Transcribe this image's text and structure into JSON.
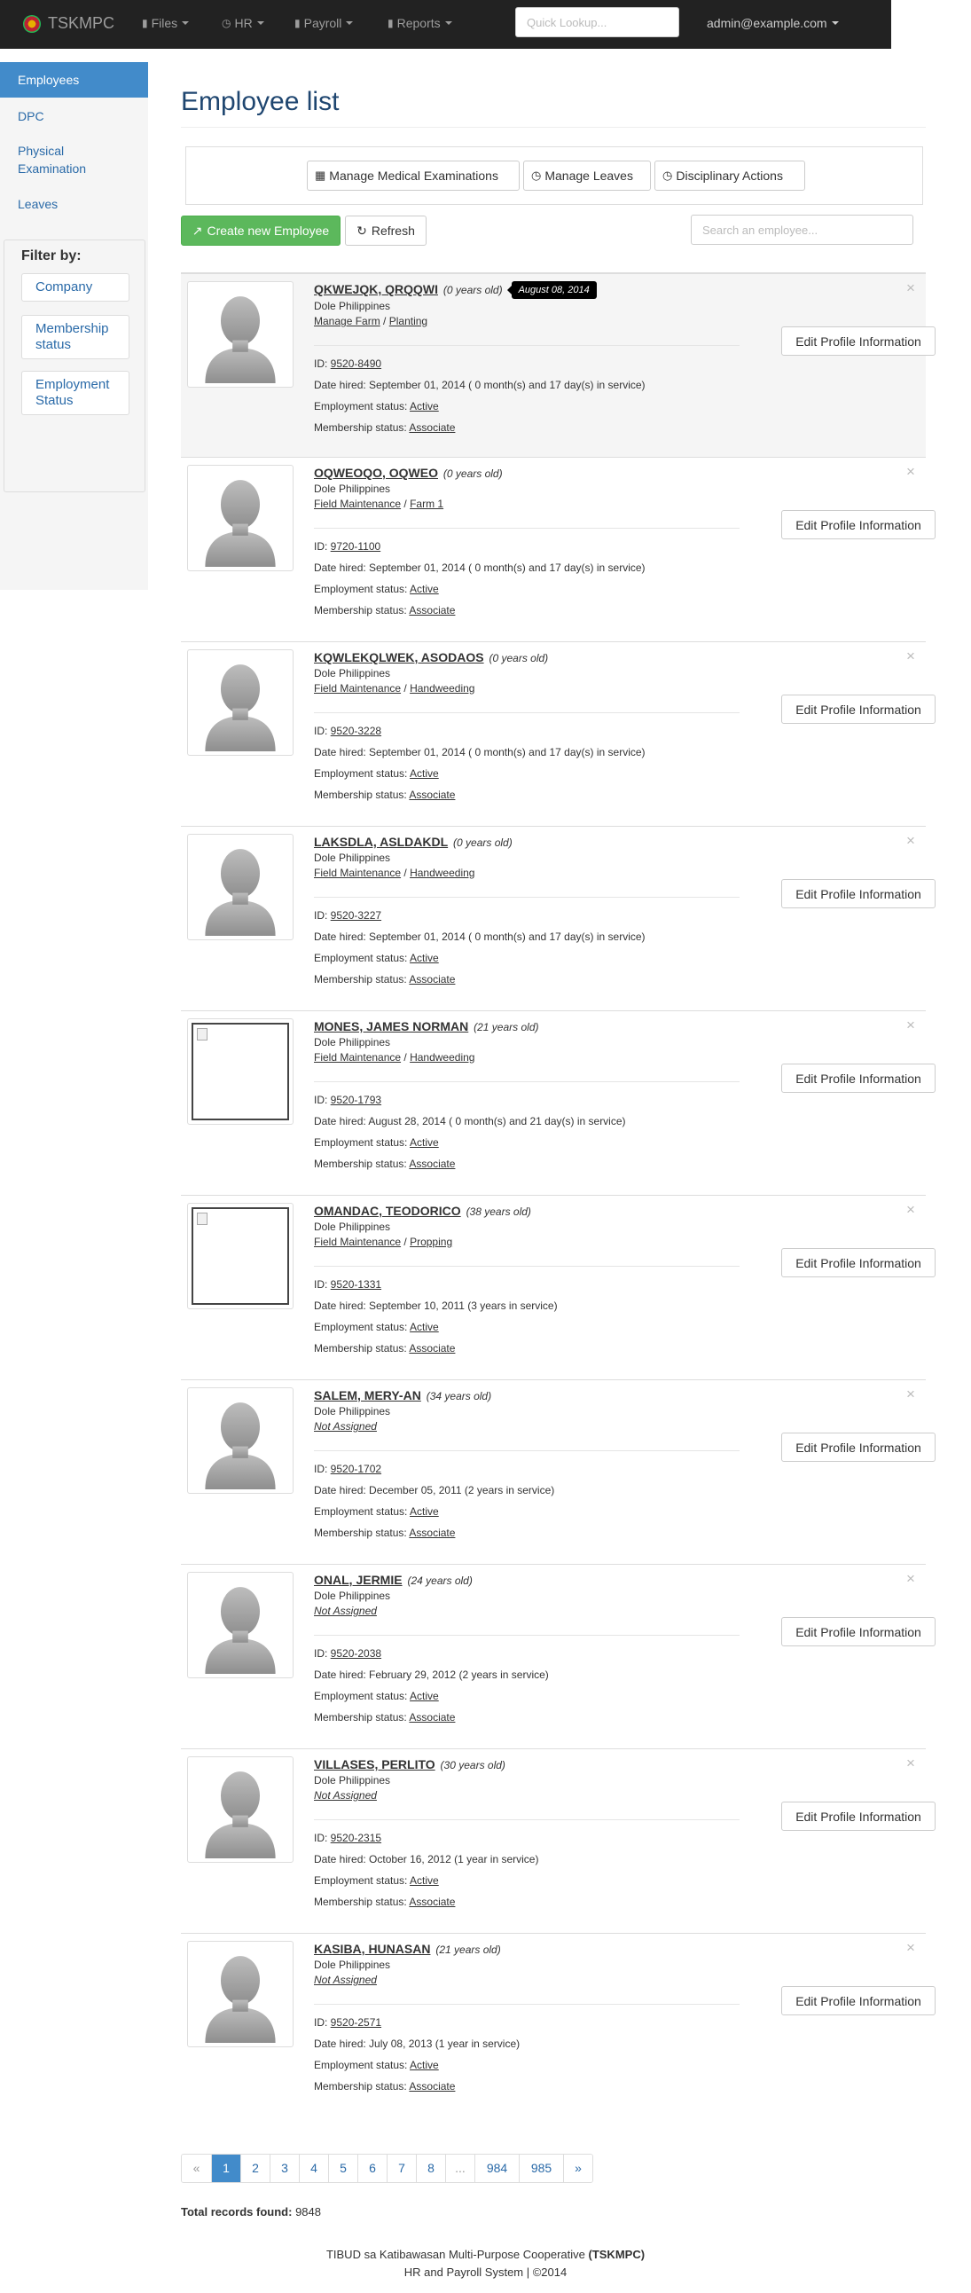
{
  "navbar": {
    "brand": "TSKMPC",
    "menus": [
      {
        "label": "Files",
        "icon": "book-icon"
      },
      {
        "label": "HR",
        "icon": "clock-icon"
      },
      {
        "label": "Payroll",
        "icon": "book-icon"
      },
      {
        "label": "Reports",
        "icon": "book-icon"
      }
    ],
    "quick_lookup_placeholder": "Quick Lookup...",
    "user": "admin@example.com"
  },
  "sidebar": {
    "items": [
      {
        "label": "Employees",
        "active": true
      },
      {
        "label": "DPC"
      },
      {
        "label": "Physical Examination"
      },
      {
        "label": "Leaves"
      }
    ],
    "filter_title": "Filter by:",
    "filters": [
      "Company",
      "Membership status",
      "Employment Status"
    ]
  },
  "page": {
    "title": "Employee list",
    "manage_buttons": [
      "Manage Medical Examinations",
      "Manage Leaves",
      "Disciplinary Actions"
    ],
    "create_label": "Create new Employee",
    "refresh_label": "Refresh",
    "search_placeholder": "Search an employee..."
  },
  "labels": {
    "id": "ID: ",
    "date_hired": "Date hired: ",
    "employment_status": "Employment status: ",
    "membership_status": "Membership status: ",
    "edit": "Edit Profile Information",
    "close": "×"
  },
  "employees": [
    {
      "name": "QKWEJQK, QRQQWI",
      "age": "(0 years old)",
      "tooltip": "August 08, 2014",
      "company": "Dole Philippines",
      "dept": "Manage Farm",
      "sub": "Planting",
      "id": "9520-8490",
      "hired": "September 01, 2014 ( 0 month(s) and 17 day(s) in service)",
      "employment": "Active",
      "membership": "Associate",
      "photo": "silhouette"
    },
    {
      "name": "OQWEOQO, OQWEO",
      "age": "(0 years old)",
      "company": "Dole Philippines",
      "dept": "Field Maintenance",
      "sub": "Farm 1",
      "id": "9720-1100",
      "hired": "September 01, 2014 ( 0 month(s) and 17 day(s) in service)",
      "employment": "Active",
      "membership": "Associate",
      "photo": "silhouette"
    },
    {
      "name": "KQWLEKQLWEK, ASODAOS",
      "age": "(0 years old)",
      "company": "Dole Philippines",
      "dept": "Field Maintenance",
      "sub": "Handweeding",
      "id": "9520-3228",
      "hired": "September 01, 2014 ( 0 month(s) and 17 day(s) in service)",
      "employment": "Active",
      "membership": "Associate",
      "photo": "silhouette"
    },
    {
      "name": "LAKSDLA, ASLDAKDL",
      "age": "(0 years old)",
      "company": "Dole Philippines",
      "dept": "Field Maintenance",
      "sub": "Handweeding",
      "id": "9520-3227",
      "hired": "September 01, 2014 ( 0 month(s) and 17 day(s) in service)",
      "employment": "Active",
      "membership": "Associate",
      "photo": "silhouette"
    },
    {
      "name": "MONES, JAMES NORMAN",
      "age": "(21 years old)",
      "company": "Dole Philippines",
      "dept": "Field Maintenance",
      "sub": "Handweeding",
      "id": "9520-1793",
      "hired": "August 28, 2014 ( 0 month(s) and 21 day(s) in service)",
      "employment": "Active",
      "membership": "Associate",
      "photo": "broken"
    },
    {
      "name": "OMANDAC, TEODORICO",
      "age": "(38 years old)",
      "company": "Dole Philippines",
      "dept": "Field Maintenance",
      "sub": "Propping",
      "id": "9520-1331",
      "hired": "September 10, 2011 (3 years in service)",
      "employment": "Active",
      "membership": "Associate",
      "photo": "broken"
    },
    {
      "name": "SALEM, MERY-AN",
      "age": "(34 years old)",
      "company": "Dole Philippines",
      "dept": "Not Assigned",
      "sub": "",
      "id": "9520-1702",
      "hired": "December 05, 2011 (2 years in service)",
      "employment": "Active",
      "membership": "Associate",
      "photo": "silhouette"
    },
    {
      "name": "ONAL, JERMIE",
      "age": "(24 years old)",
      "company": "Dole Philippines",
      "dept": "Not Assigned",
      "sub": "",
      "id": "9520-2038",
      "hired": "February 29, 2012 (2 years in service)",
      "employment": "Active",
      "membership": "Associate",
      "photo": "silhouette"
    },
    {
      "name": "VILLASES, PERLITO",
      "age": "(30 years old)",
      "company": "Dole Philippines",
      "dept": "Not Assigned",
      "sub": "",
      "id": "9520-2315",
      "hired": "October 16, 2012 (1 year in service)",
      "employment": "Active",
      "membership": "Associate",
      "photo": "silhouette"
    },
    {
      "name": "KASIBA, HUNASAN",
      "age": "(21 years old)",
      "company": "Dole Philippines",
      "dept": "Not Assigned",
      "sub": "",
      "id": "9520-2571",
      "hired": "July 08, 2013 (1 year in service)",
      "employment": "Active",
      "membership": "Associate",
      "photo": "silhouette"
    }
  ],
  "pagination": {
    "pages": [
      {
        "label": "«",
        "state": "disabled"
      },
      {
        "label": "1",
        "state": "active"
      },
      {
        "label": "2"
      },
      {
        "label": "3"
      },
      {
        "label": "4"
      },
      {
        "label": "5"
      },
      {
        "label": "6"
      },
      {
        "label": "7"
      },
      {
        "label": "8"
      },
      {
        "label": "...",
        "state": "disabled"
      },
      {
        "label": "984"
      },
      {
        "label": "985"
      },
      {
        "label": "»"
      }
    ]
  },
  "total": {
    "label": "Total records found:",
    "value": "9848"
  },
  "footer": {
    "line1_prefix": "TIBUD sa Katibawasan Multi-Purpose Cooperative ",
    "line1_abbr": "(TSKMPC)",
    "line2": "HR and Payroll System | ©2014"
  }
}
